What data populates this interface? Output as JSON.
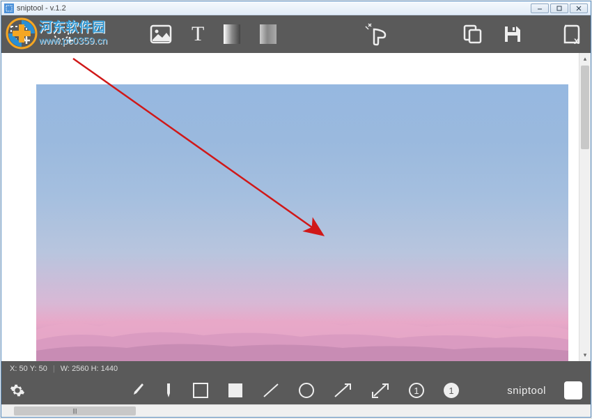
{
  "app": {
    "title": "sniptool - v.1.2",
    "brand": "sniptool"
  },
  "window_controls": {
    "minimize": "—",
    "maximize": "▢",
    "close": "✕"
  },
  "toolbar_top": {
    "rect_select": "rect-select",
    "free_select": "free-select",
    "image": "image",
    "text": "T",
    "gradient1": "gradient",
    "gradient2": "gradient2",
    "pointer": "pointer",
    "copy": "copy",
    "save": "save",
    "delete": "delete"
  },
  "status": {
    "x_label": "X:",
    "x_val": "50",
    "y_label": "Y:",
    "y_val": "50",
    "w_label": "W:",
    "w_val": "2560",
    "h_label": "H:",
    "h_val": "1440"
  },
  "toolbar_bottom": {
    "settings": "settings",
    "brush": "brush",
    "highlighter": "highlighter",
    "rect_outline": "rect-outline",
    "rect_fill": "rect-fill",
    "line": "line",
    "circle": "circle",
    "arrow_single": "arrow",
    "arrow_double": "arrow-double",
    "number_outline": "①",
    "number_fill": "❶"
  },
  "watermark": {
    "chinese": "河东软件园",
    "url": "www.pc0359.cn"
  },
  "colors": {
    "toolbar_bg": "#5a5a5a",
    "icon": "#f0f0f0",
    "arrow": "#d01818"
  }
}
